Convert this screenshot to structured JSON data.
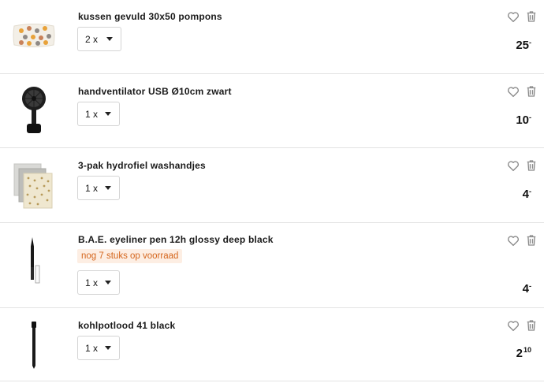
{
  "colors": {
    "stock_text": "#d4661d",
    "stock_bg": "#fdeee3",
    "icon_gray": "#8a8a8a",
    "divider": "#e3e3e3"
  },
  "icons": {
    "favorite": "heart-icon",
    "remove": "trash-icon",
    "dropdown": "caret-down-icon"
  },
  "items": [
    {
      "title": "kussen gevuld 30x50 pompons",
      "qty": "2 x",
      "price_main": "25",
      "price_suffix": "-",
      "stock": ""
    },
    {
      "title": "handventilator USB Ø10cm zwart",
      "qty": "1 x",
      "price_main": "10",
      "price_suffix": "-",
      "stock": ""
    },
    {
      "title": "3-pak hydrofiel washandjes",
      "qty": "1 x",
      "price_main": "4",
      "price_suffix": "-",
      "stock": ""
    },
    {
      "title": "B.A.E. eyeliner pen 12h glossy deep black",
      "qty": "1 x",
      "price_main": "4",
      "price_suffix": "-",
      "stock": "nog 7 stuks op voorraad"
    },
    {
      "title": "kohlpotlood 41 black",
      "qty": "1 x",
      "price_main": "2",
      "price_suffix": "10",
      "stock": ""
    }
  ]
}
